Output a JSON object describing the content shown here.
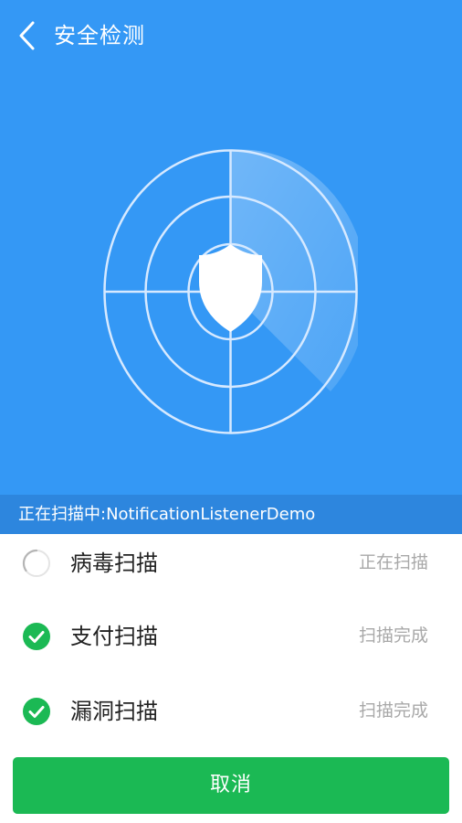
{
  "header": {
    "title": "安全检测",
    "back_icon": "chevron-left-icon"
  },
  "scanner": {
    "status_text": "正在扫描中:NotificationListenerDemo",
    "icon": "shield-icon"
  },
  "scan_items": [
    {
      "label": "病毒扫描",
      "state": "正在扫描",
      "status": "scanning"
    },
    {
      "label": "支付扫描",
      "state": "扫描完成",
      "status": "done"
    },
    {
      "label": "漏洞扫描",
      "state": "扫描完成",
      "status": "done"
    }
  ],
  "actions": {
    "cancel_label": "取消"
  },
  "colors": {
    "primary_blue": "#3498f5",
    "status_bar_blue": "#2d86de",
    "success_green": "#1bb954",
    "muted_text": "#a8a8a8"
  }
}
